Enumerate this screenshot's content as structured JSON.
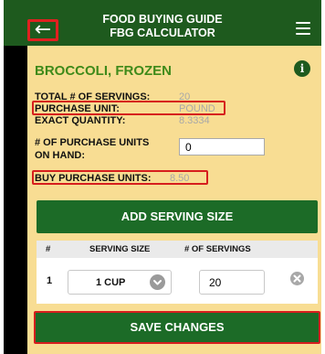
{
  "header": {
    "title_line1": "FOOD BUYING GUIDE",
    "title_line2": "FBG CALCULATOR",
    "back_icon": "arrow-left-icon",
    "menu_icon": "hamburger-menu-icon"
  },
  "food": {
    "name": "BROCCOLI, FROZEN",
    "info_icon": "info-icon"
  },
  "summary": {
    "total_servings_label": "TOTAL # OF SERVINGS:",
    "total_servings_value": "20",
    "purchase_unit_label": "PURCHASE UNIT:",
    "purchase_unit_value": "POUND",
    "exact_quantity_label": "EXACT QUANTITY:",
    "exact_quantity_value": "8.3334",
    "on_hand_label_line1": "# OF PURCHASE UNITS",
    "on_hand_label_line2": "ON HAND:",
    "on_hand_value": "0",
    "buy_units_label": "BUY PURCHASE UNITS:",
    "buy_units_value": "8.50"
  },
  "add_serving_button": "ADD SERVING SIZE",
  "table": {
    "headers": [
      "#",
      "SERVING SIZE",
      "# OF SERVINGS"
    ],
    "rows": [
      {
        "index": "1",
        "serving_size": "1 CUP",
        "servings": "20"
      }
    ]
  },
  "save_button": "SAVE CHANGES",
  "colors": {
    "header_green": "#1e5a1e",
    "panel_yellow": "#f8dd93",
    "button_green": "#1c6b27",
    "highlight_red": "#d61e1e",
    "food_name_green": "#3f8a1a"
  }
}
